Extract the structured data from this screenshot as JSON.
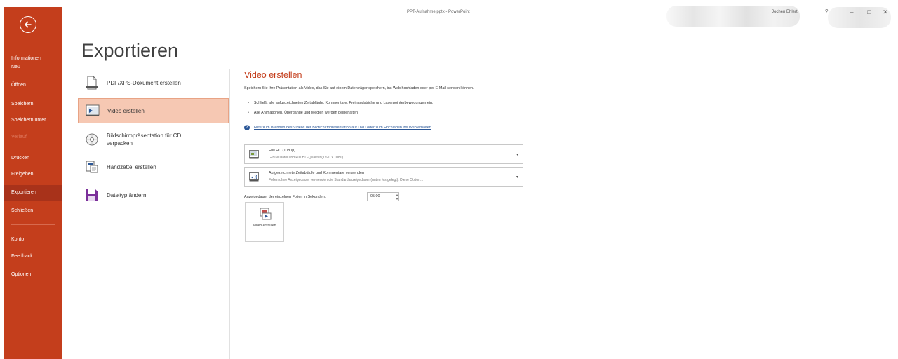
{
  "window": {
    "title": "PPT-Aufnahme.pptx  -  PowerPoint",
    "user": "Jochen Ehlert",
    "help_glyph": "?",
    "minimize_glyph": "–",
    "maximize_glyph": "□",
    "close_glyph": "✕"
  },
  "colors": {
    "accent": "#c43e1c",
    "active_option": "#f6c8b3",
    "link": "#2b5797"
  },
  "sidebar": {
    "back_icon": "back-arrow-icon",
    "items": [
      {
        "label": "Informationen",
        "state": "normal"
      },
      {
        "label": "Neu",
        "state": "normal"
      },
      {
        "label": "Öffnen",
        "state": "normal"
      },
      {
        "label": "Speichern",
        "state": "normal"
      },
      {
        "label": "Speichern unter",
        "state": "normal"
      },
      {
        "label": "Verlauf",
        "state": "disabled"
      },
      {
        "label": "Drucken",
        "state": "normal"
      },
      {
        "label": "Freigeben",
        "state": "normal"
      },
      {
        "label": "Exportieren",
        "state": "active"
      },
      {
        "label": "Schließen",
        "state": "normal"
      },
      {
        "label": "Konto",
        "state": "normal"
      },
      {
        "label": "Feedback",
        "state": "normal"
      },
      {
        "label": "Optionen",
        "state": "normal"
      }
    ]
  },
  "page": {
    "title": "Exportieren"
  },
  "export_options": [
    {
      "label": "PDF/XPS-Dokument erstellen",
      "icon": "pdf-document-icon",
      "active": false
    },
    {
      "label": "Video erstellen",
      "icon": "video-icon",
      "active": true
    },
    {
      "label": "Bildschirmpräsentation für CD verpacken",
      "icon": "cd-icon",
      "active": false
    },
    {
      "label": "Handzettel erstellen",
      "icon": "handout-icon",
      "active": false
    },
    {
      "label": "Dateityp ändern",
      "icon": "save-file-icon",
      "active": false
    }
  ],
  "video": {
    "title": "Video erstellen",
    "description": "Speichern Sie Ihre Präsentation als Video, das Sie auf einem Datenträger speichern, ins Web hochladen oder per E-Mail senden können.",
    "bullets": [
      "Schließt alle aufgezeichneten Zeitabläufe, Kommentare, Freihandstriche und Laserpointerbewegungen ein.",
      "Alle Animationen, Übergänge und Medien werden beibehalten."
    ],
    "help_link": "Hilfe zum Brennen des Videos der Bildschirmpräsentation auf DVD oder zum Hochladen ins Web erhalten",
    "quality": {
      "main": "Full HD (1080p)",
      "sub": "Große Datei und Full HD-Qualität (1920 x 1080)"
    },
    "timings": {
      "main": "Aufgezeichnete Zeitabläufe und Kommentare verwenden",
      "sub": "Folien ohne Anzeigedauer verwenden die Standardanzeigedauer (unten festgelegt). Diese Option..."
    },
    "duration_label": "Anzeigedauer der einzelnen Folien in Sekunden:",
    "duration_value": "05,00",
    "create_button_label": "Video erstellen"
  }
}
